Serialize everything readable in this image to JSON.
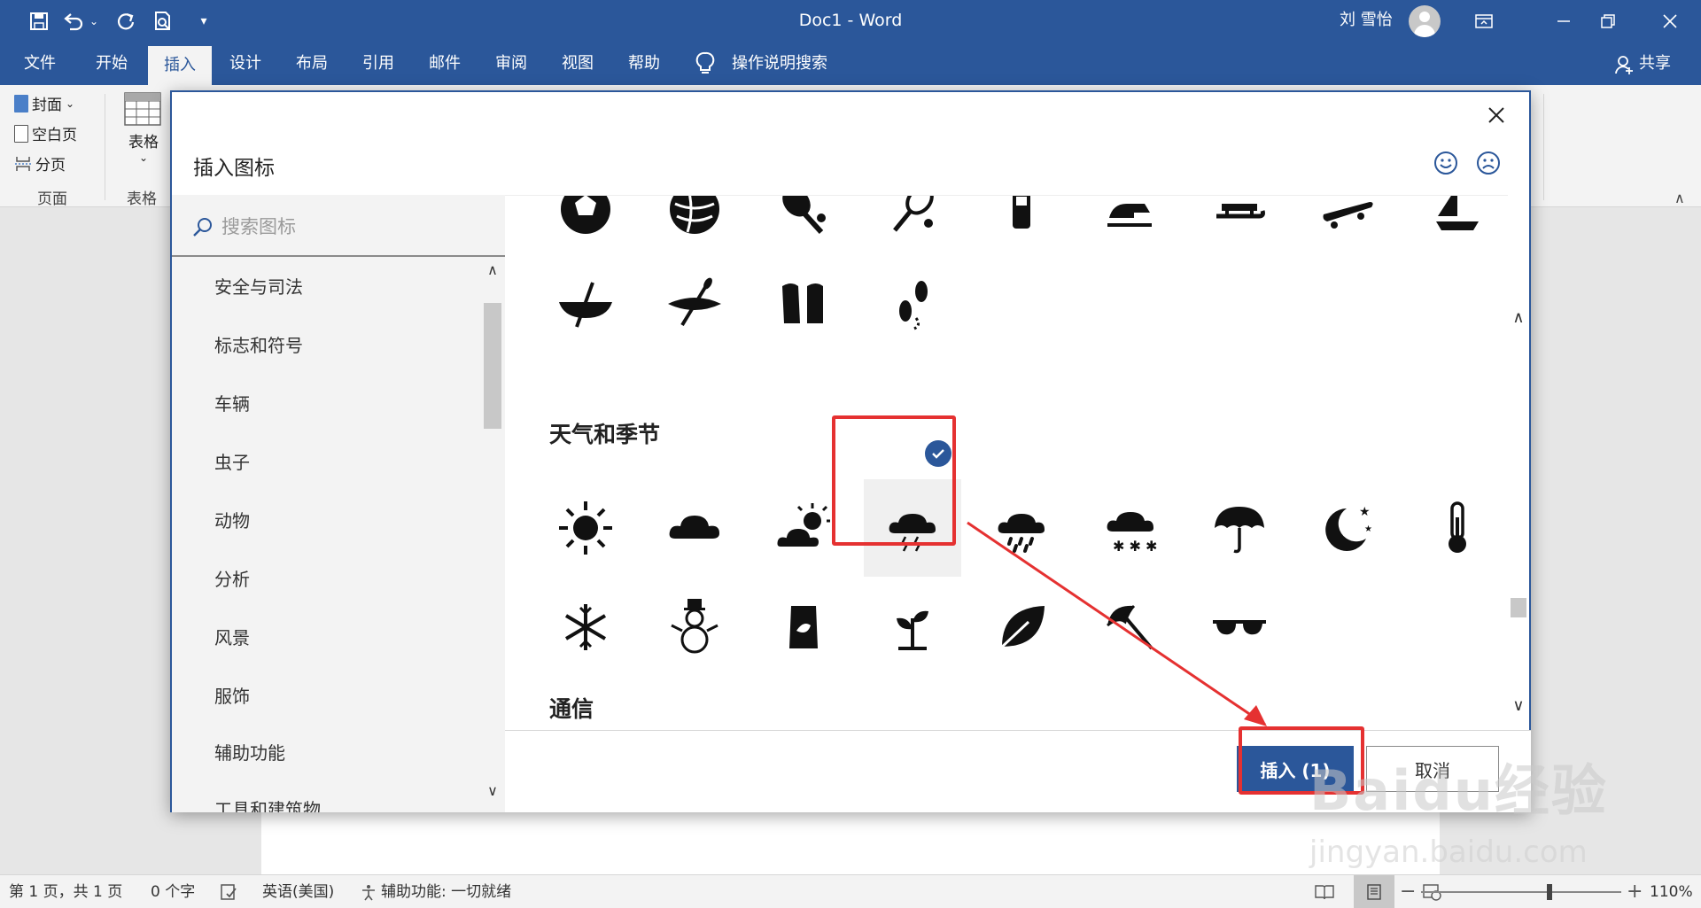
{
  "app": {
    "title": "Doc1  -  Word",
    "user": "刘 雪怡"
  },
  "menu": {
    "tabs": [
      "文件",
      "开始",
      "插入",
      "设计",
      "布局",
      "引用",
      "邮件",
      "审阅",
      "视图",
      "帮助"
    ],
    "active_tab": "插入",
    "tell_me": "操作说明搜索",
    "share": "共享"
  },
  "ribbon": {
    "pages_items": [
      "封面",
      "空白页",
      "分页"
    ],
    "pages_group": "页面",
    "table_button": "表格",
    "table_group": "表格"
  },
  "dialog": {
    "title": "插入图标",
    "search_placeholder": "搜索图标",
    "categories": [
      "安全与司法",
      "标志和符号",
      "车辆",
      "虫子",
      "动物",
      "分析",
      "风景",
      "服饰",
      "辅助功能",
      "工具和建筑物"
    ],
    "sections": {
      "weather": "天气和季节",
      "comm": "通信"
    },
    "insert_label": "插入 (1)",
    "cancel_label": "取消",
    "selected_icon": "thunderstorm-icon",
    "icons": {
      "sports_row1": [
        "soccer-ball-icon",
        "yarn-ball-icon",
        "ping-pong-icon",
        "tennis-icon",
        "phone-icon",
        "snowmobile-icon",
        "sled-icon",
        "skateboard-icon",
        "sailboat-icon"
      ],
      "sports_row2": [
        "canoe-icon",
        "kayak-icon",
        "flippers-icon",
        "footprints-icon"
      ],
      "weather_row1": [
        "sun-icon",
        "cloud-icon",
        "partly-cloudy-icon",
        "thunderstorm-icon",
        "rain-icon",
        "snow-cloud-icon",
        "umbrella-icon",
        "moon-stars-icon",
        "thermometer-icon"
      ],
      "weather_row2": [
        "snowflake-icon",
        "snowman-icon",
        "seed-bag-icon",
        "sprout-icon",
        "leaf-icon",
        "beach-umbrella-icon",
        "sunglasses-icon"
      ]
    }
  },
  "status": {
    "page": "第 1 页，共 1 页",
    "words": "0 个字",
    "language": "英语(美国)",
    "accessibility": "辅助功能: 一切就绪",
    "zoom": "110%",
    "zoom_level_percent": 110
  },
  "watermark": {
    "logo": "Baidu经验",
    "url": "jingyan.baidu.com"
  },
  "colors": {
    "brand": "#2b579a",
    "annotation": "#e53131"
  }
}
